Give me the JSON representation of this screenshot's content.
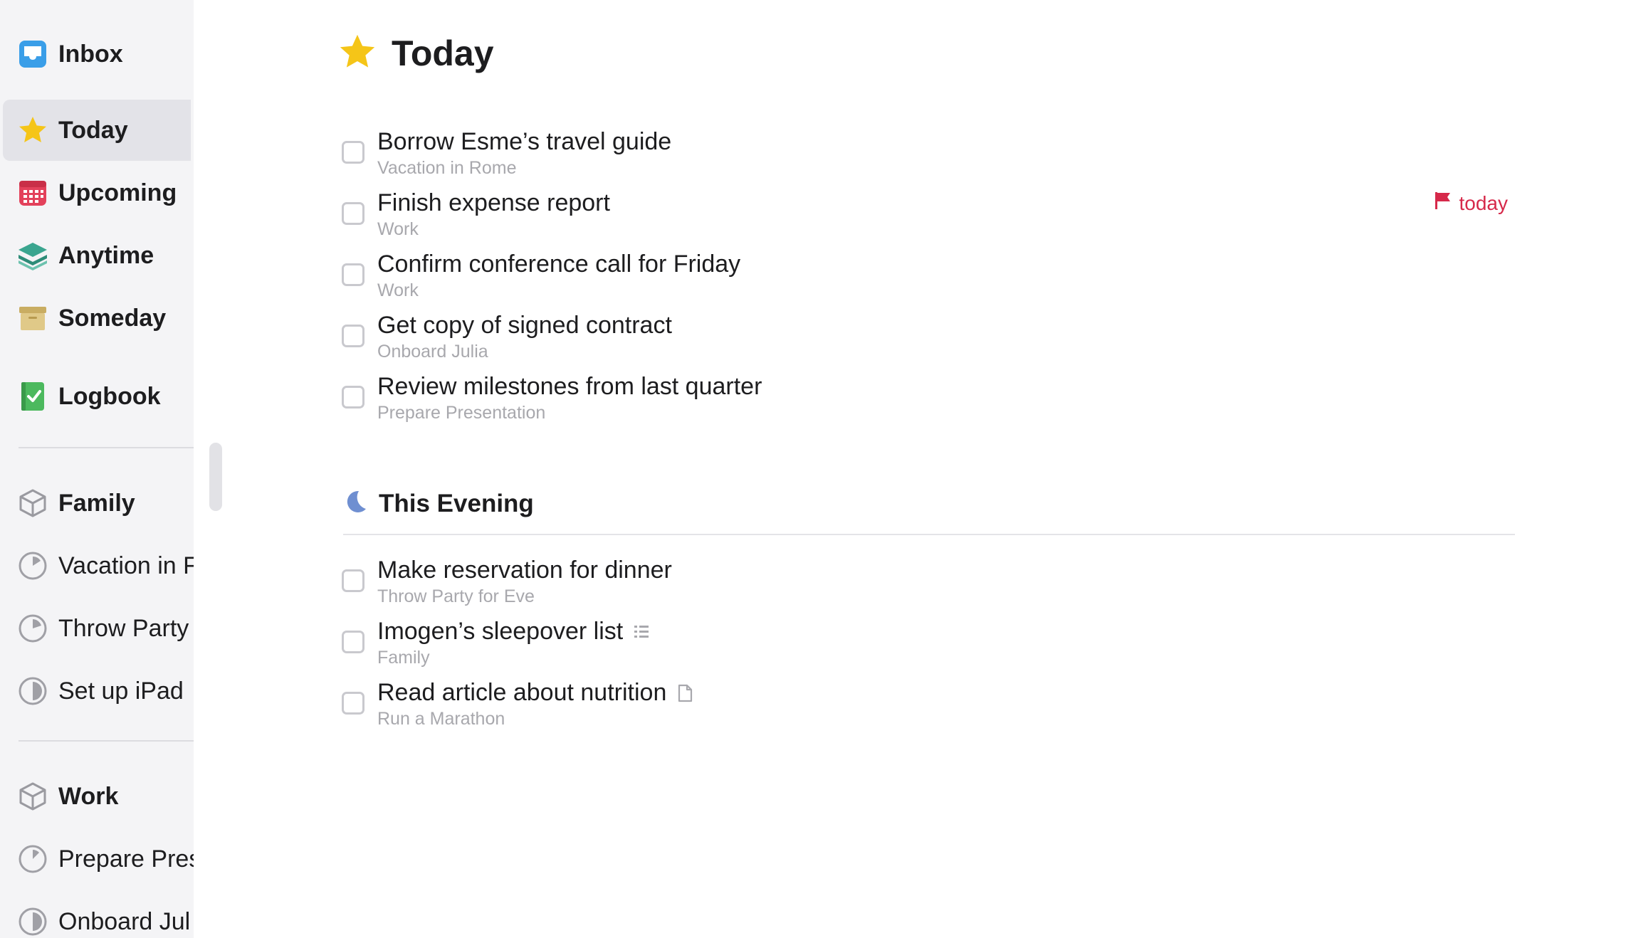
{
  "sidebar": {
    "items": [
      {
        "label": "Inbox",
        "icon": "inbox-icon"
      },
      {
        "label": "Today",
        "icon": "star-icon",
        "selected": true
      },
      {
        "label": "Upcoming",
        "icon": "calendar-icon"
      },
      {
        "label": "Anytime",
        "icon": "layers-icon"
      },
      {
        "label": "Someday",
        "icon": "archive-box-icon"
      },
      {
        "label": "Logbook",
        "icon": "logbook-check-icon"
      }
    ],
    "areas": [
      {
        "label": "Family",
        "icon": "area-cube-icon"
      },
      {
        "label": "Vacation in F",
        "icon": "project-progress-icon"
      },
      {
        "label": "Throw Party",
        "icon": "project-progress-icon"
      },
      {
        "label": "Set up iPad",
        "icon": "project-progress-icon"
      },
      {
        "label": "Work",
        "icon": "area-cube-icon"
      },
      {
        "label": "Prepare Pres",
        "icon": "project-progress-icon"
      },
      {
        "label": "Onboard Jul",
        "icon": "project-progress-icon"
      }
    ]
  },
  "main": {
    "title": "Today",
    "tasks": [
      {
        "title": "Borrow Esme’s travel guide",
        "subtitle": "Vacation in Rome"
      },
      {
        "title": "Finish expense report",
        "subtitle": "Work",
        "deadline": "today"
      },
      {
        "title": "Confirm conference call for Friday",
        "subtitle": "Work"
      },
      {
        "title": "Get copy of signed contract",
        "subtitle": "Onboard Julia"
      },
      {
        "title": "Review milestones from last quarter",
        "subtitle": "Prepare Presentation"
      }
    ],
    "evening": {
      "title": "This Evening",
      "tasks": [
        {
          "title": "Make reservation for dinner",
          "subtitle": "Throw Party for Eve"
        },
        {
          "title": "Imogen’s sleepover list",
          "subtitle": "Family",
          "icon": "checklist-icon"
        },
        {
          "title": "Read article about nutrition",
          "subtitle": "Run a Marathon",
          "icon": "note-icon"
        }
      ]
    }
  },
  "colors": {
    "accent_deadline": "#d6294a",
    "star": "#f5c518",
    "inbox": "#3a9ee8",
    "upcoming": "#e3415b",
    "anytime": "#3aa58f",
    "someday": "#d9c07a",
    "logbook": "#4cb95e",
    "evening_moon": "#6f8fd1"
  }
}
